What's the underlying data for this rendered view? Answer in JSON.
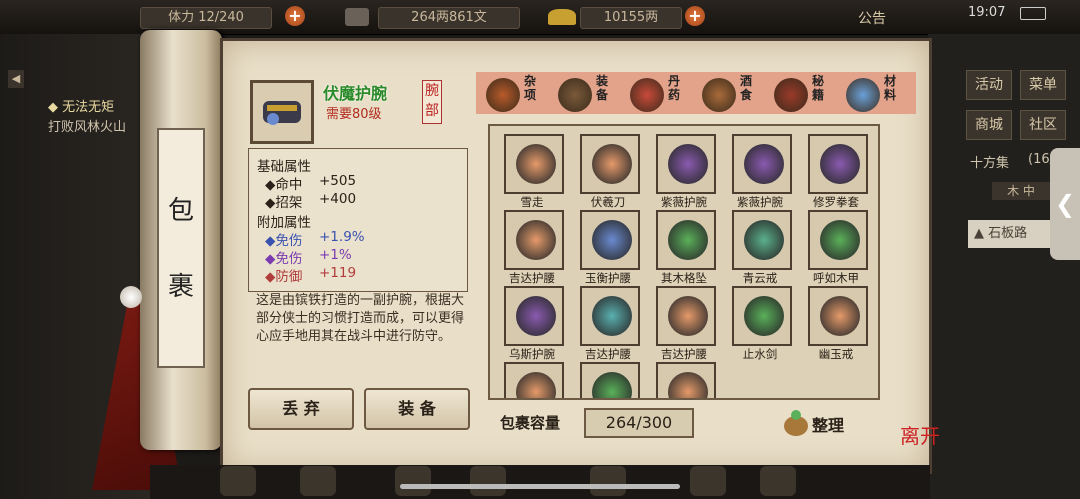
{
  "topbar": {
    "stamina": "体力 12/240",
    "money": "264两861文",
    "gold": "10155两",
    "announce": "公告",
    "clock": "19:07"
  },
  "left": {
    "quest_title": "◆ 无法无矩",
    "quest_desc": "打败风林火山"
  },
  "right": {
    "buttons": [
      "活动",
      "菜单",
      "商城",
      "社区"
    ],
    "area": "十方集",
    "area_count": "(16/",
    "sub": "木 中",
    "road": "石板路"
  },
  "scroll": {
    "chars": [
      "包",
      "裹"
    ]
  },
  "item": {
    "name": "伏魔护腕",
    "requirement": "需要80级",
    "slot": "腕部",
    "base_title": "基础属性",
    "base": [
      {
        "label": "◆命中",
        "value": "+505"
      },
      {
        "label": "◆招架",
        "value": "+400"
      }
    ],
    "extra_title": "附加属性",
    "extra": [
      {
        "label": "◆免伤",
        "value": "+1.9%",
        "color": "#3a52b0"
      },
      {
        "label": "◆免伤",
        "value": "+1%",
        "color": "#7a3cb0"
      },
      {
        "label": "◆防御",
        "value": "+119",
        "color": "#b03c3c"
      }
    ],
    "description": "这是由镔铁打造的一副护腕，根据大部分侠士的习惯打造而成，可以更得心应手地用其在战斗中进行防守。"
  },
  "actions": {
    "discard": "丢 弃",
    "equip": "装 备"
  },
  "tabs": [
    {
      "label": "杂项",
      "color": "#b85a2a"
    },
    {
      "label": "装备",
      "color": "#7a5a3a"
    },
    {
      "label": "丹药",
      "color": "#c84a3a"
    },
    {
      "label": "酒食",
      "color": "#a86a3a"
    },
    {
      "label": "秘籍",
      "color": "#9a3a2a"
    },
    {
      "label": "材料",
      "color": "#6aa0d8"
    }
  ],
  "grid": [
    {
      "name": "雪走",
      "color": "#e59a6a"
    },
    {
      "name": "伏羲刀",
      "color": "#e59a6a"
    },
    {
      "name": "紫薇护腕",
      "color": "#8a5ab0"
    },
    {
      "name": "紫薇护腕",
      "color": "#8a5ab0"
    },
    {
      "name": "修罗拳套",
      "color": "#8a5ab0"
    },
    {
      "name": "吉达护腰",
      "color": "#e59a6a"
    },
    {
      "name": "玉衡护腰",
      "color": "#6a8ad0"
    },
    {
      "name": "其木格坠",
      "color": "#5ab05a"
    },
    {
      "name": "青云戒",
      "color": "#5ab08a"
    },
    {
      "name": "呼如木甲",
      "color": "#5ab05a"
    },
    {
      "name": "乌斯护腕",
      "color": "#8a5ab0"
    },
    {
      "name": "吉达护腰",
      "color": "#5ab0b0"
    },
    {
      "name": "吉达护腰",
      "color": "#e59a6a"
    },
    {
      "name": "止水剑",
      "color": "#5ab05a"
    },
    {
      "name": "幽玉戒",
      "color": "#e59a6a"
    },
    {
      "name": "",
      "color": "#e59a6a"
    },
    {
      "name": "",
      "color": "#5ab05a"
    },
    {
      "name": "",
      "color": "#e59a6a"
    }
  ],
  "capacity": {
    "label": "包裹容量",
    "value": "264/300"
  },
  "sort": {
    "label": "整理"
  },
  "close": {
    "label": "离开"
  }
}
